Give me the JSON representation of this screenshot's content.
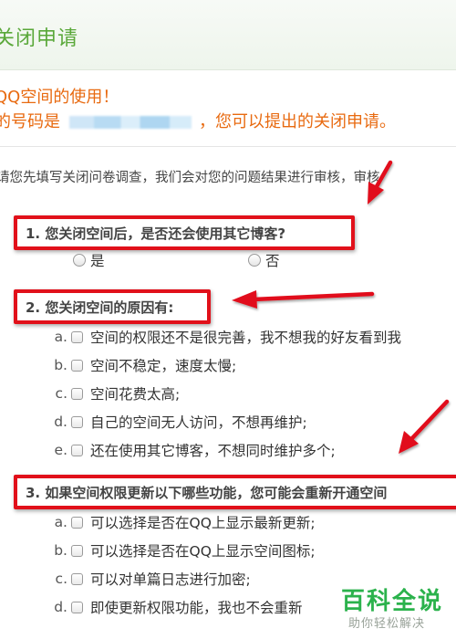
{
  "window": {
    "title": "关闭申请"
  },
  "notice": {
    "line1": "QQ空间的使用！",
    "line2_prefix": "的号码是",
    "line2_suffix": "，您可以提出的关闭申请。"
  },
  "intro": "请您先填写关闭问卷调查，我们会对您的问题结果进行审核，审核",
  "questions": [
    {
      "label": "1. 您关闭空间后，是否还会使用其它博客?",
      "options": [
        "是",
        "否"
      ]
    },
    {
      "label": "2. 您关闭空间的原因有:",
      "options": [
        {
          "letter": "a.",
          "text": "空间的权限还不是很完善，我不想我的好友看到我"
        },
        {
          "letter": "b.",
          "text": "空间不稳定，速度太慢;"
        },
        {
          "letter": "c.",
          "text": "空间花费太高;"
        },
        {
          "letter": "d.",
          "text": "自己的空间无人访问，不想再维护;"
        },
        {
          "letter": "e.",
          "text": "还在使用其它博客，不想同时维护多个;"
        }
      ]
    },
    {
      "label": "3. 如果空间权限更新以下哪些功能，您可能会重新开通空间",
      "options": [
        {
          "letter": "a.",
          "text": "可以选择是否在QQ上显示最新更新;"
        },
        {
          "letter": "b.",
          "text": "可以选择是否在QQ上显示空间图标;"
        },
        {
          "letter": "c.",
          "text": "可以对单篇日志进行加密;"
        },
        {
          "letter": "d.",
          "text": "即使更新权限功能，我也不会重新"
        }
      ]
    }
  ],
  "watermark": {
    "main": "百科全说",
    "sub": "助你轻松解决"
  },
  "colors": {
    "accent_green": "#5aa83a",
    "notice_orange": "#e86a10",
    "annotation_red": "#e1101a"
  }
}
